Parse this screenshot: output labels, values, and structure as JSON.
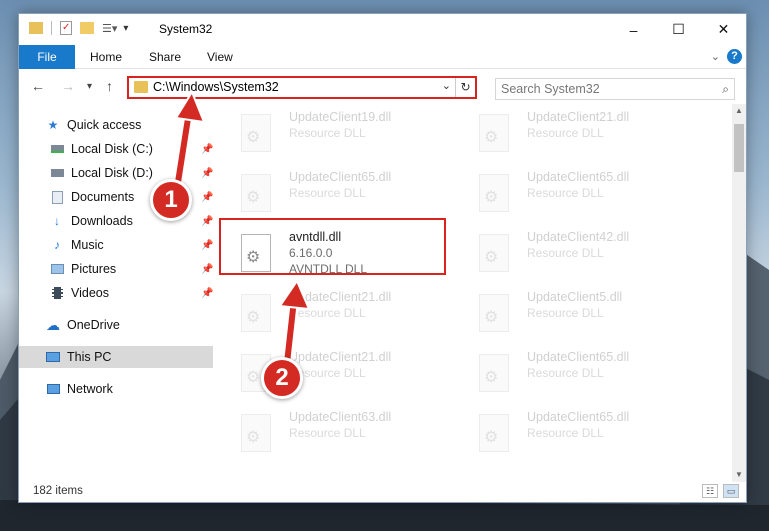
{
  "window": {
    "title": "System32",
    "controls": {
      "minimize": "–",
      "maximize": "☐",
      "close": "✕"
    }
  },
  "ribbon": {
    "tabs": [
      "File",
      "Home",
      "Share",
      "View"
    ],
    "help": "?"
  },
  "address_bar": {
    "path": "C:\\Windows\\System32"
  },
  "search": {
    "placeholder": "Search System32"
  },
  "sidebar": {
    "items": [
      {
        "label": "Quick access",
        "icon": "star-icon",
        "pinned": false
      },
      {
        "label": "Local Disk (C:)",
        "icon": "drive-icon",
        "pinned": true
      },
      {
        "label": "Local Disk (D:)",
        "icon": "drive-icon",
        "pinned": true
      },
      {
        "label": "Documents",
        "icon": "documents-icon",
        "pinned": true
      },
      {
        "label": "Downloads",
        "icon": "downloads-icon",
        "pinned": true
      },
      {
        "label": "Music",
        "icon": "music-icon",
        "pinned": true
      },
      {
        "label": "Pictures",
        "icon": "pictures-icon",
        "pinned": true
      },
      {
        "label": "Videos",
        "icon": "videos-icon",
        "pinned": true
      },
      {
        "label": "OneDrive",
        "icon": "onedrive-icon",
        "pinned": false
      },
      {
        "label": "This PC",
        "icon": "pc-icon",
        "pinned": false,
        "selected": true
      },
      {
        "label": "Network",
        "icon": "network-icon",
        "pinned": false
      }
    ]
  },
  "files": {
    "left": [
      {
        "name": "UpdateClient19.dll",
        "type": "Resource DLL"
      },
      {
        "name": "UpdateClient65.dll",
        "type": "Resource DLL"
      },
      {
        "name": "avntdll.dll",
        "version": "6.16.0.0",
        "type": "AVNTDLL DLL",
        "highlighted": true
      },
      {
        "name": "UpdateClient21.dll",
        "type": "Resource DLL"
      },
      {
        "name": "UpdateClient21.dll",
        "type": "Resource DLL"
      },
      {
        "name": "UpdateClient63.dll",
        "type": "Resource DLL"
      }
    ],
    "right": [
      {
        "name": "UpdateClient21.dll",
        "type": "Resource DLL"
      },
      {
        "name": "UpdateClient65.dll",
        "type": "Resource DLL"
      },
      {
        "name": "UpdateClient42.dll",
        "type": "Resource DLL"
      },
      {
        "name": "UpdateClient5.dll",
        "type": "Resource DLL"
      },
      {
        "name": "UpdateClient65.dll",
        "type": "Resource DLL"
      },
      {
        "name": "UpdateClient65.dll",
        "type": "Resource DLL"
      }
    ]
  },
  "status": {
    "item_count": "182 items"
  },
  "callouts": {
    "step1": "1",
    "step2": "2"
  },
  "colors": {
    "accent": "#1979ca",
    "callout": "#d42a24",
    "selected": "#d9d9d9"
  }
}
